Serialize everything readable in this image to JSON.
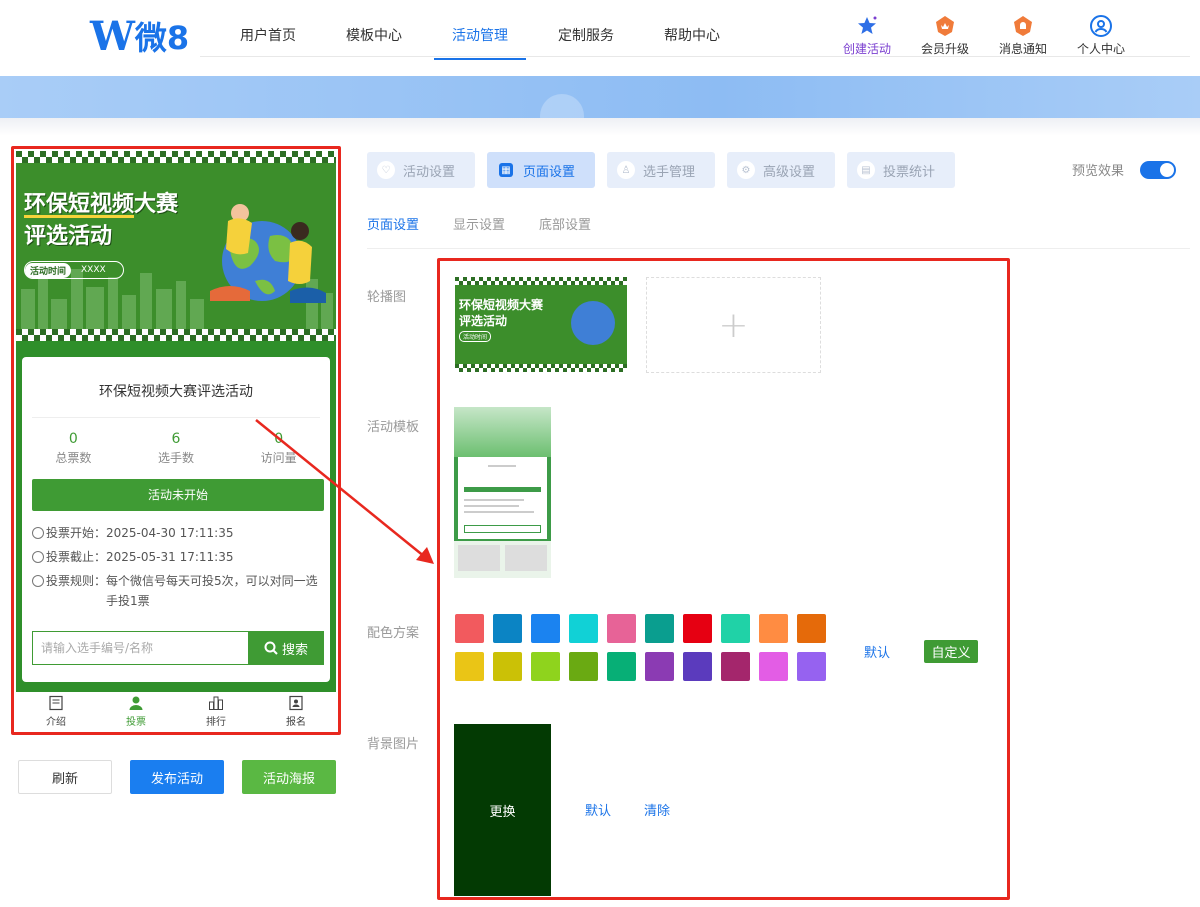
{
  "brand": {
    "logo_mark": "W",
    "logo_text": "微8"
  },
  "nav": {
    "items": [
      {
        "label": "用户首页"
      },
      {
        "label": "模板中心"
      },
      {
        "label": "活动管理"
      },
      {
        "label": "定制服务"
      },
      {
        "label": "帮助中心"
      }
    ],
    "active": "活动管理"
  },
  "top_right": {
    "create": "创建活动",
    "upgrade": "会员升级",
    "notify": "消息通知",
    "account": "个人中心"
  },
  "preview": {
    "poster_title_line1": "环保短视频大赛",
    "poster_title_line2": "评选活动",
    "poster_time_tag": "活动时间",
    "poster_time_value": "XXXX",
    "card_title": "环保短视频大赛评选活动",
    "stats": [
      {
        "value": "0",
        "label": "总票数"
      },
      {
        "value": "6",
        "label": "选手数"
      },
      {
        "value": "0",
        "label": "访问量"
      }
    ],
    "status_button": "活动未开始",
    "vote_start_label": "投票开始：",
    "vote_start_value": "2025-04-30 17:11:35",
    "vote_end_label": "投票截止：",
    "vote_end_value": "2025-05-31 17:11:35",
    "vote_rule_label": "投票规则：",
    "vote_rule_value": "每个微信号每天可投5次，可以对同一选手投1票",
    "search_placeholder": "请输入选手编号/名称",
    "search_button": "搜索",
    "tabbar": [
      {
        "label": "介绍",
        "icon": "intro-icon"
      },
      {
        "label": "投票",
        "icon": "vote-icon"
      },
      {
        "label": "排行",
        "icon": "rank-icon"
      },
      {
        "label": "报名",
        "icon": "signup-icon"
      }
    ],
    "active_tab": "投票"
  },
  "actions": {
    "refresh": "刷新",
    "publish": "发布活动",
    "poster": "活动海报"
  },
  "steps": [
    {
      "label": "活动设置",
      "icon": "heart-icon"
    },
    {
      "label": "页面设置",
      "icon": "layout-icon"
    },
    {
      "label": "选手管理",
      "icon": "user-icon"
    },
    {
      "label": "高级设置",
      "icon": "settings-icon"
    },
    {
      "label": "投票统计",
      "icon": "stats-icon"
    }
  ],
  "active_step": "页面设置",
  "preview_toggle": {
    "label": "预览效果",
    "on": true
  },
  "subtabs": [
    {
      "label": "页面设置"
    },
    {
      "label": "显示设置"
    },
    {
      "label": "底部设置"
    }
  ],
  "active_subtab": "页面设置",
  "settings": {
    "carousel_label": "轮播图",
    "carousel_thumb_line1": "环保短视频大赛",
    "carousel_thumb_line2": "评选活动",
    "carousel_thumb_time": "活动时间",
    "template_label": "活动模板",
    "palette_label": "配色方案",
    "palette_colors": [
      "#f25a5e",
      "#0b84c4",
      "#1b83f0",
      "#11d1d6",
      "#e76397",
      "#0a9e8f",
      "#e60012",
      "#20d2a7",
      "#ff8c42",
      "#e56a0a",
      "#eac516",
      "#cbc106",
      "#8fd31d",
      "#6aaa12",
      "#07af76",
      "#8b3bb3",
      "#5b3bbd",
      "#a4266c",
      "#e35de5",
      "#9662f0"
    ],
    "palette_default": "默认",
    "palette_custom": "自定义",
    "bg_label": "背景图片",
    "bg_replace": "更换",
    "bg_default": "默认",
    "bg_clear": "清除"
  }
}
